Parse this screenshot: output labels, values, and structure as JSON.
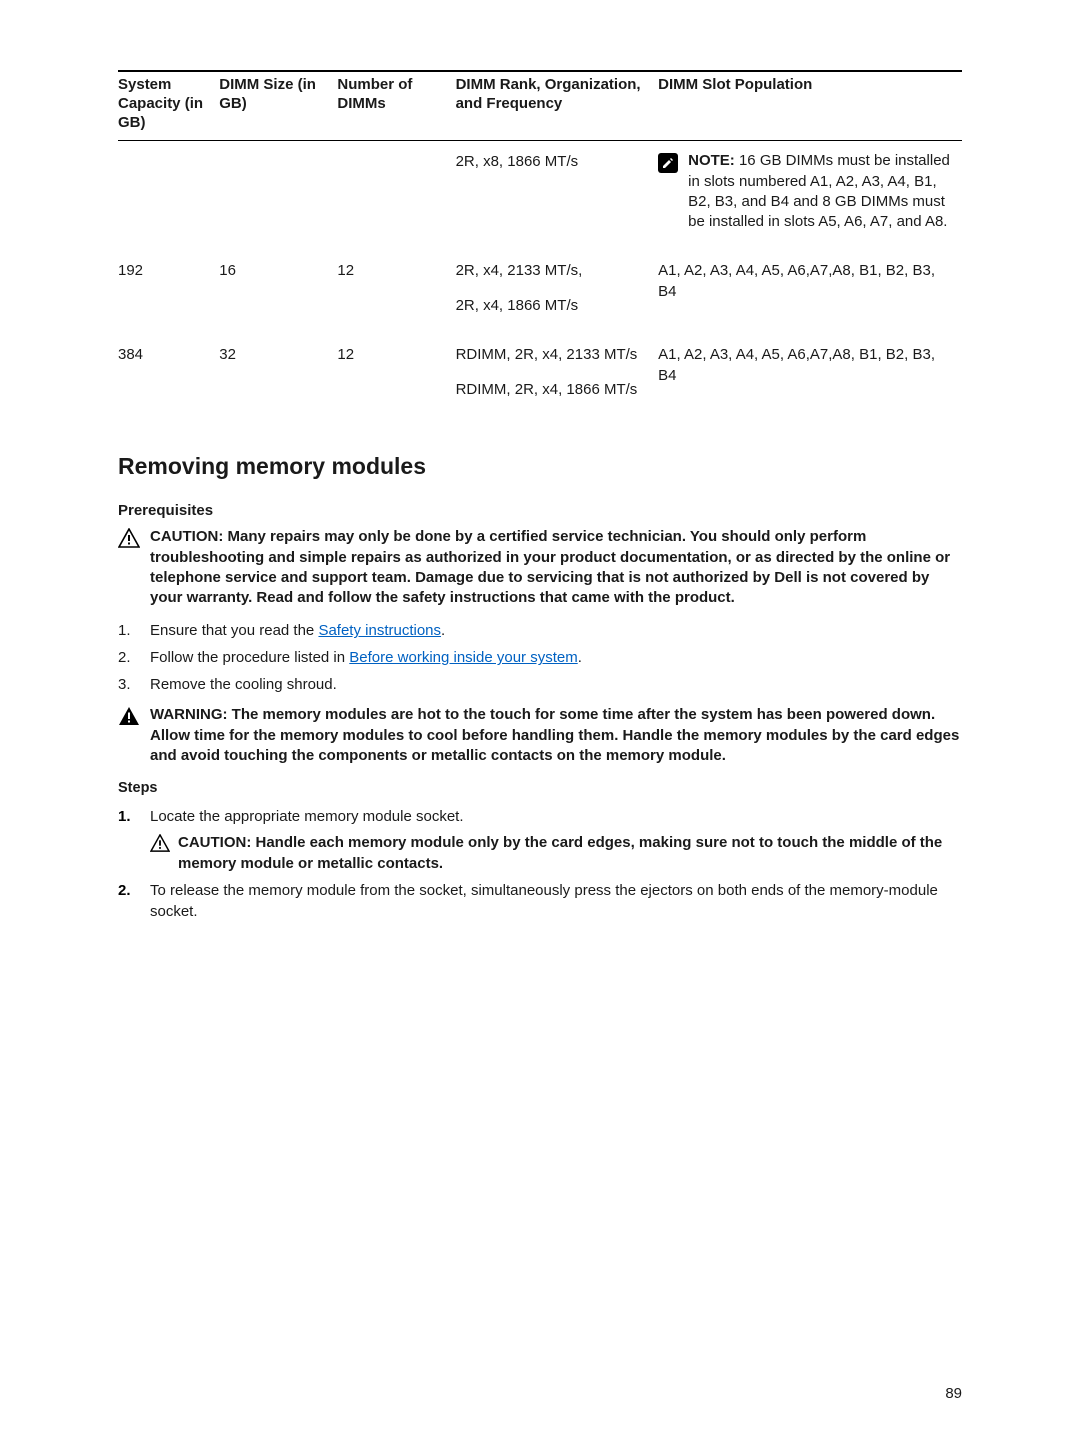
{
  "table": {
    "headers": {
      "sys": "System Capacity (in GB)",
      "dimm": "DIMM Size (in GB)",
      "num": "Number of DIMMs",
      "rank": "DIMM Rank, Organization, and Frequency",
      "slot": "DIMM Slot Population"
    },
    "row1": {
      "freq": "2R, x8, 1866 MT/s",
      "note_label": "NOTE:",
      "note_text": " 16 GB DIMMs must be installed in slots numbered A1, A2, A3, A4, B1, B2, B3, and B4 and 8 GB DIMMs must be installed in slots A5, A6, A7, and A8."
    },
    "row2": {
      "sys": "192",
      "dimm": "16",
      "num": "12",
      "freq1": "2R, x4, 2133 MT/s,",
      "freq2": "2R, x4, 1866 MT/s",
      "slot": "A1, A2, A3, A4, A5, A6,A7,A8, B1, B2, B3, B4"
    },
    "row3": {
      "sys": "384",
      "dimm": "32",
      "num": "12",
      "freq1": "RDIMM, 2R, x4, 2133 MT/s",
      "freq2": "RDIMM, 2R, x4, 1866 MT/s",
      "slot": "A1, A2, A3, A4, A5, A6,A7,A8, B1, B2, B3, B4"
    }
  },
  "section_title": "Removing memory modules",
  "prereq_heading": "Prerequisites",
  "caution1": "CAUTION: Many repairs may only be done by a certified service technician. You should only perform troubleshooting and simple repairs as authorized in your product documentation, or as directed by the online or telephone service and support team. Damage due to servicing that is not authorized by Dell is not covered by your warranty. Read and follow the safety instructions that came with the product.",
  "prereq_steps": {
    "s1_pre": "Ensure that you read the ",
    "s1_link": "Safety instructions",
    "s1_post": ".",
    "s2_pre": "Follow the procedure listed in ",
    "s2_link": "Before working inside your system",
    "s2_post": ".",
    "s3": "Remove the cooling shroud."
  },
  "warning1": "WARNING: The memory modules are hot to the touch for some time after the system has been powered down. Allow time for the memory modules to cool before handling them. Handle the memory modules by the card edges and avoid touching the components or metallic contacts on the memory module.",
  "steps_heading": "Steps",
  "steps": {
    "s1": "Locate the appropriate memory module socket.",
    "s1_caution": "CAUTION: Handle each memory module only by the card edges, making sure not to touch the middle of the memory module or metallic contacts.",
    "s2": "To release the memory module from the socket, simultaneously press the ejectors on both ends of the memory-module socket."
  },
  "page_number": "89"
}
